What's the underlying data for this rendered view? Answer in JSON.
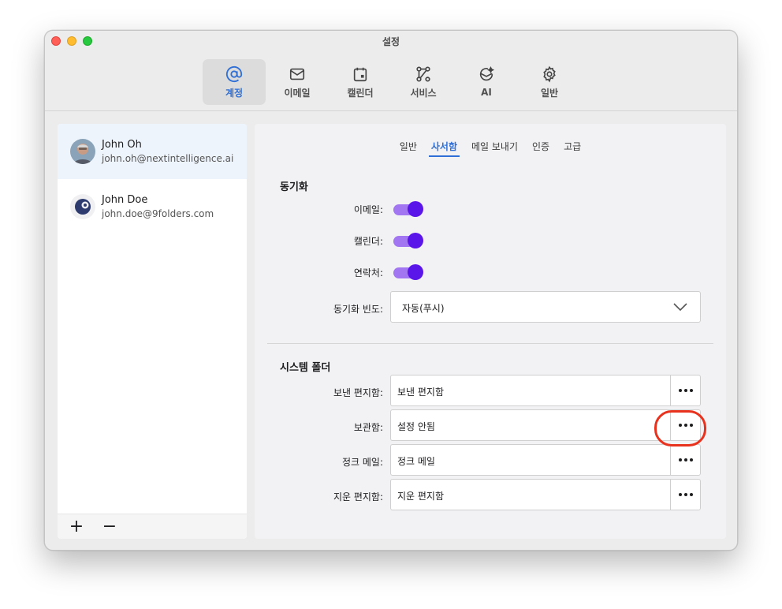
{
  "window": {
    "title": "설정"
  },
  "toolbar": {
    "tabs": [
      {
        "label": "계정",
        "icon": "at-icon",
        "active": true
      },
      {
        "label": "이메일",
        "icon": "envelope-icon"
      },
      {
        "label": "캘린더",
        "icon": "calendar-icon"
      },
      {
        "label": "서비스",
        "icon": "services-icon"
      },
      {
        "label": "AI",
        "icon": "ai-sparkle-icon"
      },
      {
        "label": "일반",
        "icon": "gear-icon"
      }
    ],
    "accent_color": "#2f6fd6"
  },
  "accounts": [
    {
      "name": "John Oh",
      "email": "john.oh@nextintelligence.ai",
      "selected": true,
      "avatar": "photo-avatar"
    },
    {
      "name": "John Doe",
      "email": "john.doe@9folders.com",
      "avatar": "logo-avatar"
    }
  ],
  "sidebar_footer": {
    "add": "+",
    "remove": "−"
  },
  "subtabs": [
    {
      "label": "일반"
    },
    {
      "label": "사서함",
      "active": true
    },
    {
      "label": "메일 보내기"
    },
    {
      "label": "인증"
    },
    {
      "label": "고급"
    }
  ],
  "sync": {
    "title": "동기화",
    "toggles": [
      {
        "label": "이메일:",
        "on": true
      },
      {
        "label": "캘린더:",
        "on": true
      },
      {
        "label": "연락처:",
        "on": true
      }
    ],
    "frequency_label": "동기화 빈도:",
    "frequency_value": "자동(푸시)",
    "toggle_color": "#5a16e8"
  },
  "system_folders": {
    "title": "시스템 폴더",
    "rows": [
      {
        "label": "보낸 편지함:",
        "value": "보낸 편지함"
      },
      {
        "label": "보관함:",
        "value": "설정 안됨"
      },
      {
        "label": "정크 메일:",
        "value": "정크 메일"
      },
      {
        "label": "지운 편지함:",
        "value": "지운 편지함"
      }
    ]
  },
  "annotation_color": "#e8321e"
}
